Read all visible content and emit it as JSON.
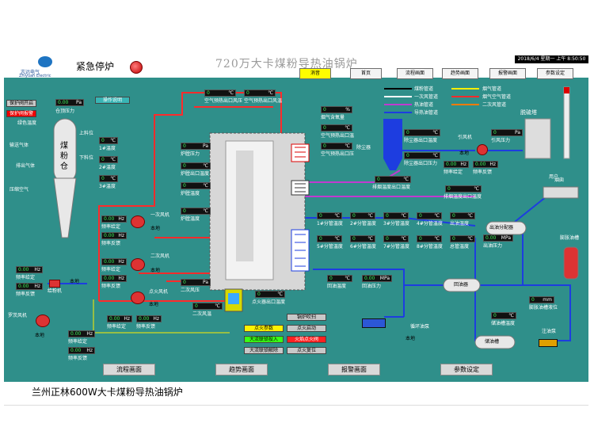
{
  "header": {
    "logo_name": "志远电气",
    "logo_name_en": "Zhiyuan Electric",
    "estop_label": "紧急停炉",
    "main_title": "720万大卡煤粉导热油锅炉",
    "datetime": "2018/6/4 星期一 上午 8:50:50",
    "buttons": [
      {
        "label": "消音",
        "selected": true
      },
      {
        "label": "首页"
      },
      {
        "label": "流程画面"
      },
      {
        "label": "趋势画面"
      },
      {
        "label": "报警画面"
      },
      {
        "label": "参数设定"
      }
    ]
  },
  "left_panel": {
    "protect_open": "保护阀开启",
    "protect_alarm": "保护阀报警",
    "bin_pressure_tag": {
      "value": "0.00",
      "unit": "Pa"
    },
    "bin_pressure_label": "仓顶压力",
    "op_manual": "操作说明",
    "bin_label": "煤粉仓",
    "bin_upper": "上料位",
    "bin_lower": "下料位",
    "feed_temp": "绿色温度",
    "air_in": "输送气体",
    "air_out": "排出气体",
    "compress_air": "压缩空气",
    "temps": [
      {
        "value": "0",
        "label": "1#温度"
      },
      {
        "value": "0",
        "label": "2#温度"
      },
      {
        "value": "0",
        "label": "3#温度"
      }
    ]
  },
  "fans": {
    "primary": {
      "name": "一次风机",
      "local": "本地",
      "freq_set": "频率给定",
      "freq_fb": "频率反馈",
      "v1": "0.00",
      "v2": "0.00",
      "unit": "Hz"
    },
    "secondary": {
      "name": "二次风机",
      "local": "本地",
      "freq_set": "频率给定",
      "freq_fb": "频率反馈",
      "v1": "0.00",
      "v2": "0.00",
      "unit": "Hz"
    },
    "supply": {
      "name": "给粉机",
      "local": "本地",
      "freq_set": "频率给定",
      "freq_fb": "频率反馈",
      "v1": "0.00",
      "v2": "0.00",
      "unit": "Hz"
    },
    "fire_fan": {
      "name": "点火风机",
      "local": "本地",
      "freq_set": "频率给定",
      "freq_fb": "频率反馈",
      "v1": "0.00",
      "v2": "0.00",
      "unit": "Hz"
    },
    "seal": {
      "name": "罗茨风机",
      "local": "本地",
      "freq_set": "频率给定",
      "freq_fb": "频率反馈",
      "v1": "0.00",
      "v2": "0.00",
      "unit": "Hz"
    },
    "induced": {
      "name": "引风机",
      "local": "本地",
      "freq_set": "频率给定",
      "freq_fb": "频率反馈",
      "v1": "0.00",
      "v2": "0.00",
      "unit": "Hz"
    }
  },
  "boiler": {
    "air_preheat_out_t1": {
      "value": "0",
      "unit": "℃",
      "label": "空气预热出口风压"
    },
    "air_preheat_out_t2": {
      "value": "0",
      "unit": "℃",
      "label": "空气预热出口风温"
    },
    "furnace_pressure": {
      "value": "0",
      "unit": "Pa",
      "label": "炉膛压力"
    },
    "furnace_temp1": {
      "value": "0",
      "unit": "℃",
      "label": "炉膛出口温度"
    },
    "furnace_temp2": {
      "value": "0",
      "unit": "℃",
      "label": "炉膛温度"
    },
    "hearth_temp": {
      "value": "0",
      "unit": "℃",
      "label": "炉膛温度"
    },
    "second_air_pressure": {
      "value": "0",
      "unit": "Pa",
      "label": "二次风压"
    },
    "second_air_temp": {
      "value": "0",
      "unit": "℃",
      "label": "二次风温"
    },
    "burner_temp": {
      "value": "0",
      "unit": "℃",
      "label": "点火器出口温度"
    },
    "smoke_o2": {
      "value": "0",
      "unit": "%",
      "label": "烟气含氧量"
    },
    "preheat_in_temp": {
      "value": "0",
      "unit": "℃",
      "label": "空气预热出口温"
    },
    "preheat_out_temp": {
      "value": "0",
      "unit": "℃",
      "label": "空气预热出口压"
    },
    "econ_out_temp": {
      "value": "0",
      "unit": "℃",
      "label": "烟气出口温度"
    },
    "coil_temps": [
      {
        "value": "0",
        "label": "1#分管温度"
      },
      {
        "value": "0",
        "label": "2#分管温度"
      },
      {
        "value": "0",
        "label": "3#分管温度"
      },
      {
        "value": "0",
        "label": "4#分管温度"
      },
      {
        "value": "0",
        "label": "5#分管温度"
      },
      {
        "value": "0",
        "label": "6#分管温度"
      },
      {
        "value": "0",
        "label": "7#分管温度"
      },
      {
        "value": "0",
        "label": "8#分管温度"
      }
    ],
    "total_temp": {
      "value": "0",
      "label": "总管温度"
    },
    "outlet_temp": {
      "value": "0",
      "label": "出油温度"
    },
    "outlet_pressure": {
      "value": "0.00",
      "unit": "MPa",
      "label": "出油压力"
    },
    "return_temp": {
      "value": "0",
      "label": "回油温度"
    },
    "return_pressure": {
      "value": "0.00",
      "unit": "MPa",
      "label": "回油压力"
    },
    "return_temp2": {
      "value": "0",
      "label": "回油温度"
    }
  },
  "fluegas": {
    "dust_label": "除尘器",
    "dust_in_temp": {
      "value": "0",
      "unit": "℃",
      "label": "除尘器出口温度"
    },
    "dust_out_temp": {
      "value": "0",
      "unit": "℃",
      "label": "除尘器出口压力"
    },
    "duct_temp": {
      "value": "0",
      "unit": "℃",
      "label": "排烟温度出口温度"
    },
    "exhaust_temp": {
      "value": "0",
      "unit": "℃",
      "label": "排烟温度出口温度"
    },
    "induced_pressure": {
      "value": "0",
      "unit": "Pa",
      "label": "引风压力"
    },
    "desulf_label": "脱硫塔",
    "chimney_label": "烟囱"
  },
  "legend": [
    {
      "label": "煤粉管道",
      "color": "#000000"
    },
    {
      "label": "一次风管道",
      "color": "#ffffff"
    },
    {
      "label": "热油管道",
      "color": "#c03ad0"
    },
    {
      "label": "烟气管道",
      "color": "#ffee00"
    },
    {
      "label": "烟气空气管道",
      "color": "#ff2b2b"
    },
    {
      "label": "二次风管道",
      "color": "#ff7b00"
    },
    {
      "label": "导热油管道",
      "color": "#1d3de0"
    }
  ],
  "oil_system": {
    "dispense_tank": "出油分配器",
    "expansion_tank": "膨胀油槽",
    "return_tank": "回油器",
    "storage_tank": "储油槽",
    "users": "用户",
    "circ_pump": "循环油泵",
    "circ_local": "本地",
    "fill_pump": "注油泵",
    "exp_level": {
      "value": "0",
      "label": "膨胀油槽液位"
    },
    "exp_temp": {
      "value": "0",
      "label": "储油槽温度"
    }
  },
  "controls": {
    "ignite_params": "点火参数",
    "furnace_purge": "锅炉吹扫",
    "fire_start": "点火启动",
    "fire_stop": "大流联锁投入",
    "fire_on": "大流联锁解除",
    "fire_reset": "点火复位",
    "fire_unload": "火焰点火阀"
  },
  "bottom_nav": [
    "流程画面",
    "趋势画面",
    "报警画面",
    "参数设定"
  ],
  "caption": "兰州正林600W大卡煤粉导热油锅炉"
}
